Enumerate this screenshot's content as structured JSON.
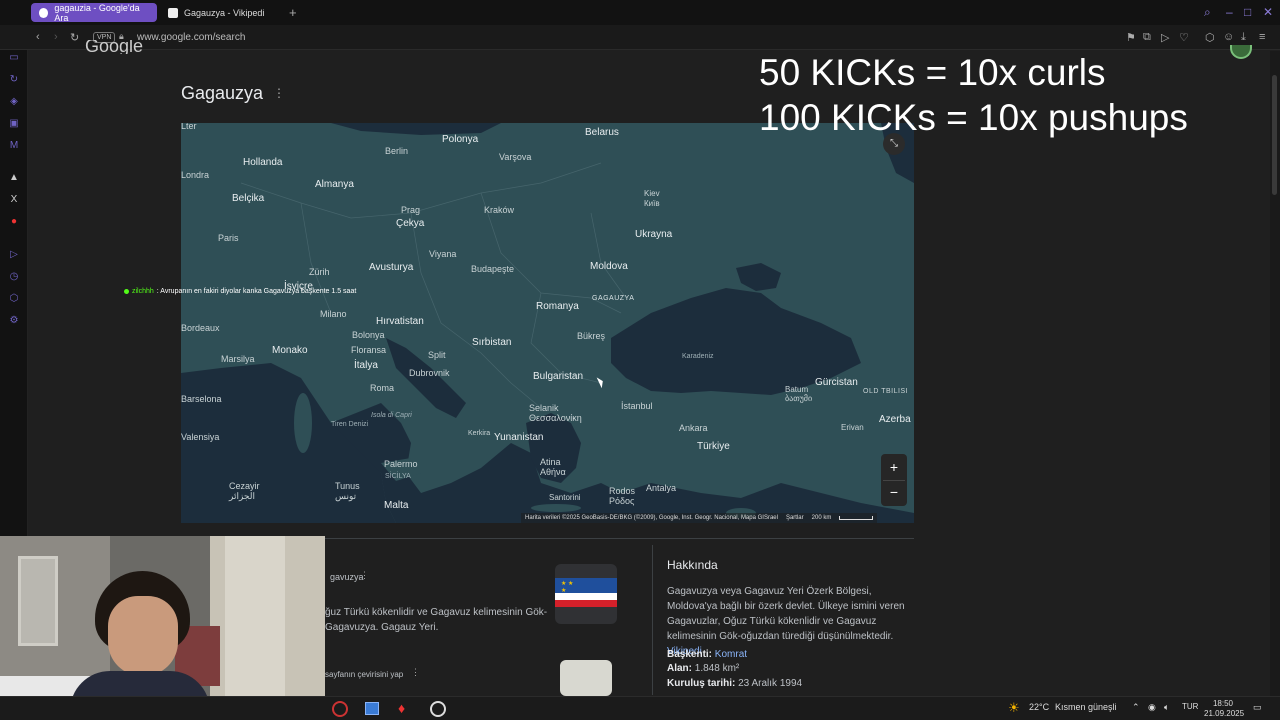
{
  "tabs": [
    {
      "label": "gagauzia - Google'da Ara",
      "active": true
    },
    {
      "label": "Gagauzya - Vikipedi",
      "active": false
    }
  ],
  "address": {
    "vpn": "VPN",
    "url": "www.google.com/search"
  },
  "google_logo_partial": "Google",
  "page_title": "Gagauzya",
  "map": {
    "countries": [
      {
        "name": "Belarus"
      },
      {
        "name": "Polonya"
      },
      {
        "name": "Hollanda"
      },
      {
        "name": "Almanya"
      },
      {
        "name": "Belçika"
      },
      {
        "name": "Çekya"
      },
      {
        "name": "Ukrayna"
      },
      {
        "name": "Avusturya"
      },
      {
        "name": "Moldova"
      },
      {
        "name": "Romanya"
      },
      {
        "name": "Hırvatistan"
      },
      {
        "name": "Sırbistan"
      },
      {
        "name": "Monako"
      },
      {
        "name": "İtalya"
      },
      {
        "name": "Bulgaristan"
      },
      {
        "name": "Yunanistan"
      },
      {
        "name": "Türkiye"
      },
      {
        "name": "Gürcistan"
      },
      {
        "name": "Malta"
      },
      {
        "name": "İsviçre"
      },
      {
        "name": "Azerba"
      }
    ],
    "cities": [
      {
        "name": "Berlin"
      },
      {
        "name": "Varşova"
      },
      {
        "name": "Londra"
      },
      {
        "name": "Kiev\nКиїв"
      },
      {
        "name": "Paris"
      },
      {
        "name": "Prag"
      },
      {
        "name": "Kraków"
      },
      {
        "name": "Zürih"
      },
      {
        "name": "Viyana"
      },
      {
        "name": "Budapeşte"
      },
      {
        "name": "Milano"
      },
      {
        "name": "Bükreş"
      },
      {
        "name": "Bolonya"
      },
      {
        "name": "Floransa"
      },
      {
        "name": "Split"
      },
      {
        "name": "Marsilya"
      },
      {
        "name": "Roma"
      },
      {
        "name": "Dubrovnik"
      },
      {
        "name": "Batum\nბათუმი"
      },
      {
        "name": "İstanbul"
      },
      {
        "name": "Selanik\nΘεσσαλονίκη"
      },
      {
        "name": "Ankara"
      },
      {
        "name": "Palermo"
      },
      {
        "name": "Atina\nΑθήνα"
      },
      {
        "name": "Cezayir\nالجزائر"
      },
      {
        "name": "Tunus\nتونس"
      },
      {
        "name": "Rodos\nΡόδος"
      },
      {
        "name": "Antalya"
      },
      {
        "name": "Santorini"
      },
      {
        "name": "Kerkira"
      },
      {
        "name": "Bordeaux"
      },
      {
        "name": "Barselona"
      },
      {
        "name": "Valensiya"
      },
      {
        "name": "Erivan"
      },
      {
        "name": "Old Tbilisi"
      },
      {
        "name": "Lter"
      }
    ],
    "region_label": "GAGAUZYA",
    "seas": [
      {
        "name": "Karadeniz"
      },
      {
        "name": "Tiren Denizi"
      },
      {
        "name": "Isola di Capri"
      },
      {
        "name": "SİCİLYA"
      }
    ],
    "attribution": "Harita verileri ©2025 GeoBasis-DE/BKG (©2009), Google, Inst. Geogr. Nacional, Mapa GISrael",
    "terms": "Şartlar",
    "scale": "200 km"
  },
  "chat_message": {
    "user": "zilchhh",
    "text": ": Avrupanın en fakiri diyolar kanka Gagavuzya başkente 1.5 saat"
  },
  "overlay": {
    "line1": "50 KICKs = 10x curls",
    "line2": "100 KICKs = 10x pushups"
  },
  "result": {
    "source": "gavuzya",
    "snippet1": "ğuz Türkü kökenlidir ve Gagavuz kelimesinin Gök-",
    "snippet2": "Gagavuzya. Gagauz Yeri.",
    "translate": "sayfanın çevirisini yap"
  },
  "about": {
    "heading": "Hakkında",
    "description": "Gagavuzya veya Gagavuz Yeri Özerk Bölgesi, Moldova'ya bağlı bir özerk devlet. Ülkeye ismini veren Gagavuzlar, Oğuz Türkü kökenlidir ve Gagavuz kelimesinin Gök-oğuzdan türediği düşünülmektedir.",
    "wiki_link": "Vikipedi",
    "capital_label": "Başkenti:",
    "capital_value": "Komrat",
    "area_label": "Alan:",
    "area_value": "1.848 km²",
    "founded_label": "Kuruluş tarihi:",
    "founded_value": "23 Aralık 1994"
  },
  "taskbar": {
    "weather": "22°C",
    "weather_text": "Kısmen güneşli",
    "lang": "TUR",
    "time": "18:50",
    "date": "21.09.2025"
  },
  "colors": {
    "accent": "#6f63c4",
    "map_water": "#1c2d3c",
    "map_land": "#2f4f56"
  }
}
